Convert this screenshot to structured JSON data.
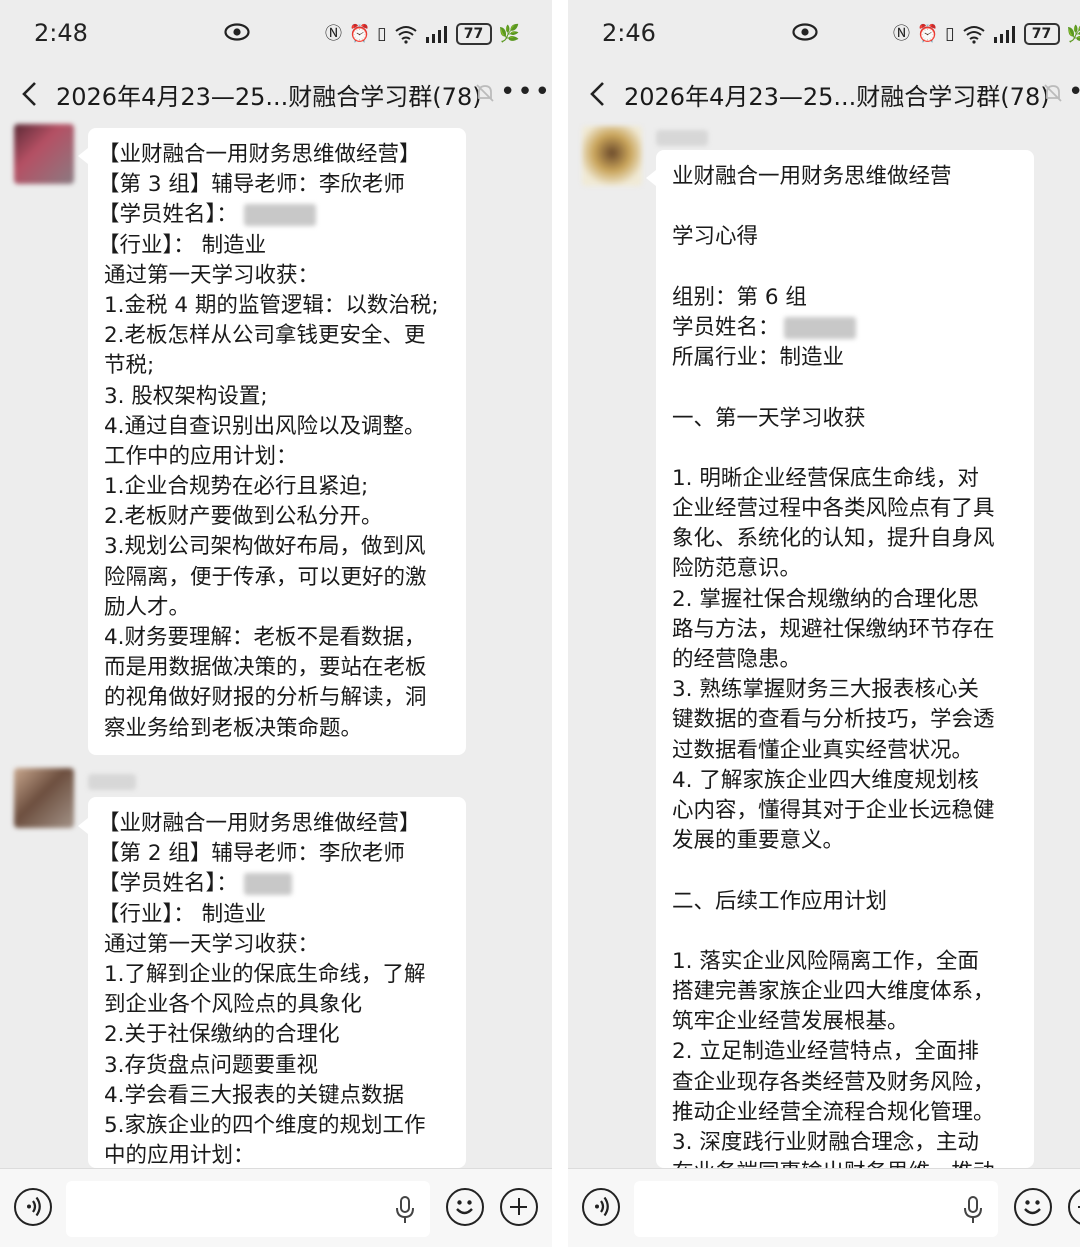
{
  "left": {
    "status": {
      "time": "2:48",
      "battery": "77"
    },
    "header": {
      "title": "2026年4月23—25...财融合学习群(78)"
    },
    "messages": [
      {
        "lines": [
          "【业财融合一用财务思维做经营】",
          "【第 3 组】辅导老师：李欣老师",
          "【学员姓名】：",
          "【行业】：  制造业",
          "通过第一天学习收获：",
          "1.金税 4 期的监管逻辑：以数治税;",
          "2.老板怎样从公司拿钱更安全、更",
          "节税;",
          "3. 股权架构设置;",
          "4.通过自查识别出风险以及调整。",
          "工作中的应用计划：",
          "1.企业合规势在必行且紧迫;",
          "2.老板财产要做到公私分开。",
          "3.规划公司架构做好布局，做到风",
          "险隔离，便于传承，可以更好的激",
          "励人才。",
          "4.财务要理解：老板不是看数据，",
          "而是用数据做决策的，要站在老板",
          "的视角做好财报的分析与解读，洞",
          "察业务给到老板决策命题。"
        ]
      },
      {
        "lines": [
          "【业财融合一用财务思维做经营】",
          "【第 2 组】辅导老师：李欣老师",
          "【学员姓名】：",
          "【行业】：  制造业",
          "通过第一天学习收获：",
          "1.了解到企业的保底生命线，了解",
          "到企业各个风险点的具象化",
          "2.关于社保缴纳的合理化",
          "3.存货盘点问题要重视",
          "4.学会看三大报表的关键点数据",
          "5.家族企业的四个维度的规划工作",
          "中的应用计划："
        ]
      }
    ]
  },
  "right": {
    "status": {
      "time": "2:46",
      "battery": "77"
    },
    "header": {
      "title": "2026年4月23—25...财融合学习群(78)"
    },
    "messages": [
      {
        "lines": [
          "业财融合一用财务思维做经营",
          "",
          "学习心得",
          "",
          "组别：第 6 组",
          "学员姓名：",
          "所属行业：制造业",
          "",
          "一、第一天学习收获",
          "",
          "1. 明晰企业经营保底生命线，对",
          "企业经营过程中各类风险点有了具",
          "象化、系统化的认知，提升自身风",
          "险防范意识。",
          "2. 掌握社保合规缴纳的合理化思",
          "路与方法，规避社保缴纳环节存在",
          "的经营隐患。",
          "3. 熟练掌握财务三大报表核心关",
          "键数据的查看与分析技巧，学会透",
          "过数据看懂企业真实经营状况。",
          "4. 了解家族企业四大维度规划核",
          "心内容，懂得其对于企业长远稳健",
          "发展的重要意义。",
          "",
          "二、后续工作应用计划",
          "",
          "1. 落实企业风险隔离工作，全面",
          "搭建完善家族企业四大维度体系，",
          "筑牢企业经营发展根基。",
          "2. 立足制造业经营特点，全面排",
          "查企业现存各类经营及财务风险，",
          "推动企业经营全流程合规化管理。",
          "3. 深度践行业财融合理念，主动",
          "在业务端同事输出财务思维，推动"
        ]
      }
    ]
  },
  "colors": {
    "chat_background": "#ededed",
    "bubble_background": "#ffffff",
    "input_bar_background": "#f7f7f7"
  },
  "icons": [
    "back-arrow-icon",
    "eye-icon",
    "nfc-icon",
    "alarm-icon",
    "vibrate-icon",
    "wifi-icon",
    "signal-icon",
    "battery-icon",
    "leaf-icon",
    "mute-bell-icon",
    "more-dots-icon",
    "voice-icon",
    "mic-icon",
    "emoji-icon",
    "plus-icon"
  ]
}
